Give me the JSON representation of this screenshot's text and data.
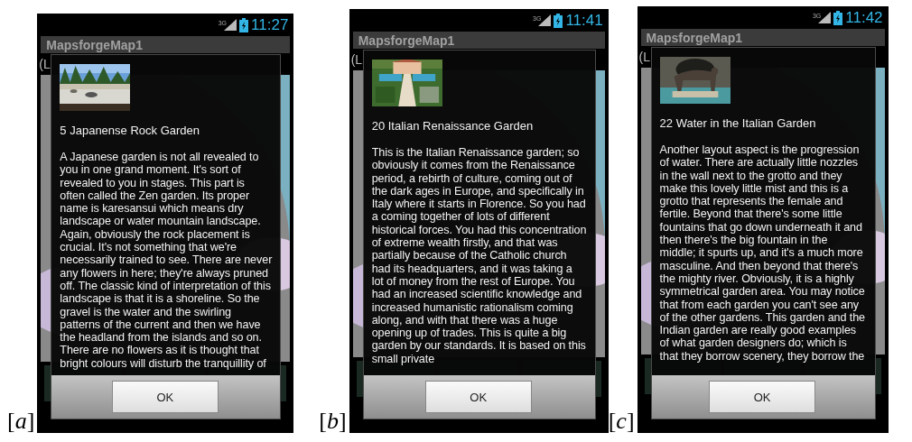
{
  "panels": [
    {
      "label": "[*a*]",
      "status_bar": {
        "network": "3G",
        "time": "11:27"
      },
      "app_title": "MapsforgeMap1",
      "subtitle": "(L",
      "dialog": {
        "title": "5 Japanense Rock Garden",
        "body": "A Japanese garden is not all revealed to you in one grand moment. It's sort of revealed to you in stages. This part is often called the Zen garden. Its proper name is karesansui which means dry landscape or water mountain landscape. Again, obviously the rock placement is crucial. It's not something that we're necessarily trained to see. There are never any flowers in here; they're always pruned off. The classic kind of interpretation of this landscape is that it is a shoreline. So the gravel is the water and the swirling patterns of the current and then we have the headland from the islands and so on. There are no flowers as it is thought that bright colours will disturb the tranquillity of",
        "button": "OK"
      }
    },
    {
      "label": "[*b*]",
      "status_bar": {
        "network": "3G",
        "time": "11:41"
      },
      "app_title": "MapsforgeMap1",
      "subtitle": "(L",
      "dialog": {
        "title": "20 Italian Renaissance Garden",
        "body": "This is the Italian Renaissance garden; so obviously it comes from the Renaissance period, a rebirth of culture, coming out of the dark ages in Europe, and specifically in Italy where it starts in Florence. So you had a coming together of lots of different historical forces. You had this concentration of extreme wealth firstly, and that was partially because of the Catholic church had its headquarters, and it was taking a lot of money from the rest of Europe. You had an increased scientific knowledge and increased humanistic rationalism coming along, and with that there was a huge opening up of trades. This is quite a big garden by our standards. It is based on this small private",
        "button": "OK"
      }
    },
    {
      "label": "[*c*]",
      "status_bar": {
        "network": "3G",
        "time": "11:42"
      },
      "app_title": "MapsforgeMap1",
      "subtitle": "(L",
      "dialog": {
        "title": "22 Water in the Italian Garden",
        "body": "Another layout aspect is the progression of water. There are actually little nozzles in the wall next to the grotto and they make this lovely little mist and this is a grotto that represents the female and fertile. Beyond that there's some little fountains that go down underneath it and then there's the big fountain in the middle; it spurts up, and it's a much more masculine. And then beyond that there's the mighty river. Obviously, it is a highly symmetrical garden area. You may notice that from each garden you can't see any of the other gardens. This garden and the Indian garden are really good examples of what garden designers do; which is that they borrow scenery, they borrow the",
        "button": "OK"
      }
    }
  ]
}
